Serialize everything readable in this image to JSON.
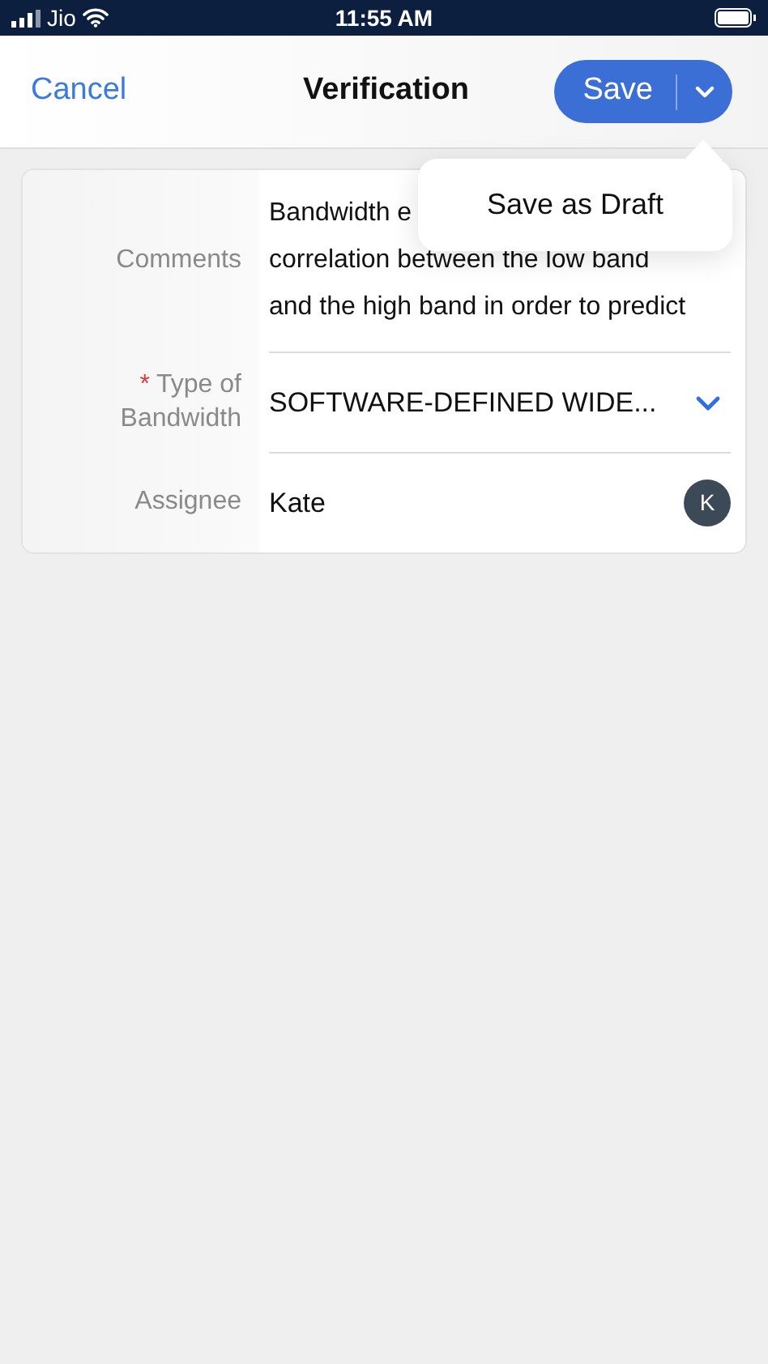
{
  "status_bar": {
    "carrier": "Jio",
    "time": "11:55 AM"
  },
  "nav": {
    "cancel": "Cancel",
    "title": "Verification",
    "save": "Save"
  },
  "menu": {
    "items": [
      "Save as Draft"
    ]
  },
  "fields": [
    {
      "kind": "text",
      "label": "Comments",
      "lines": [
        "Bandwidth e",
        "correlation between the low band",
        "and the high band in order to predict"
      ]
    },
    {
      "kind": "select",
      "label_lines": [
        "Type of",
        "Bandwidth"
      ],
      "required_mark": "*",
      "value": "SOFTWARE-DEFINED WIDE..."
    },
    {
      "kind": "person",
      "label": "Assignee",
      "value": "Kate",
      "avatar": "K"
    }
  ]
}
